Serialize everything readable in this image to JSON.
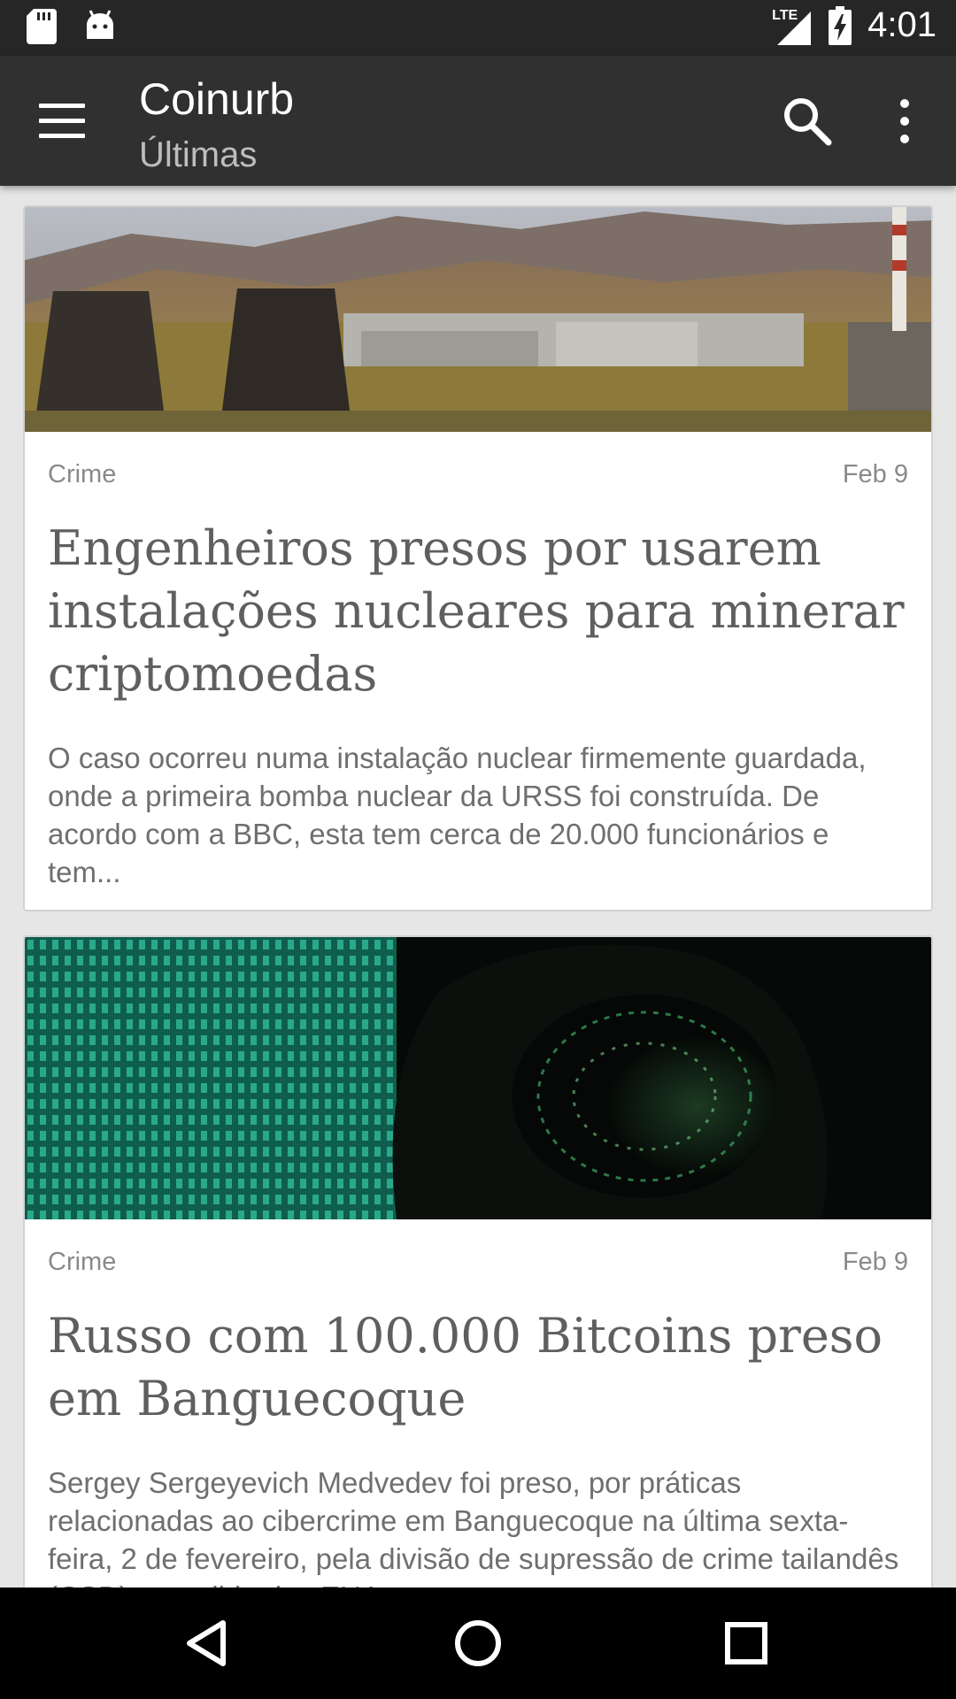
{
  "status_bar": {
    "time": "4:01",
    "network": "LTE",
    "icons": [
      "sd-card-icon",
      "android-icon",
      "signal-icon",
      "battery-charging-icon"
    ]
  },
  "app_bar": {
    "title": "Coinurb",
    "subtitle": "Últimas",
    "icons": [
      "menu-icon",
      "search-icon",
      "more-vert-icon"
    ]
  },
  "articles": [
    {
      "image": "nuclear-plant-landscape-image",
      "category": "Crime",
      "date": "Feb 9",
      "headline": "Engenheiros presos por usarem instalações nucleares para minerar criptomoedas",
      "summary": "O caso ocorreu numa instalação nuclear firmemente guardada, onde a primeira bomba nuclear da URSS foi construída. De acordo com a BBC, esta tem cerca de 20.000 funcionários e tem..."
    },
    {
      "image": "hooded-hacker-binary-code-image",
      "category": "Crime",
      "date": "Feb 9",
      "headline": "Russo com 100.000 Bitcoins preso em Banguecoque",
      "summary": "Sergey Sergeyevich Medvedev foi preso, por práticas relacionadas ao cibercrime  em Banguecoque na última sexta-feira, 2 de fevereiro, pela divisão de supressão de crime tailandês (CSD), a pedido dos EUA"
    }
  ],
  "nav_bar": {
    "icons": [
      "back-icon",
      "home-icon",
      "recents-icon"
    ]
  },
  "colors": {
    "status_bar": "#262626",
    "app_bar": "#303030",
    "background": "#e6e6e6",
    "card": "#ffffff",
    "headline": "#5f5f5f",
    "meta": "#8a8a8a"
  }
}
